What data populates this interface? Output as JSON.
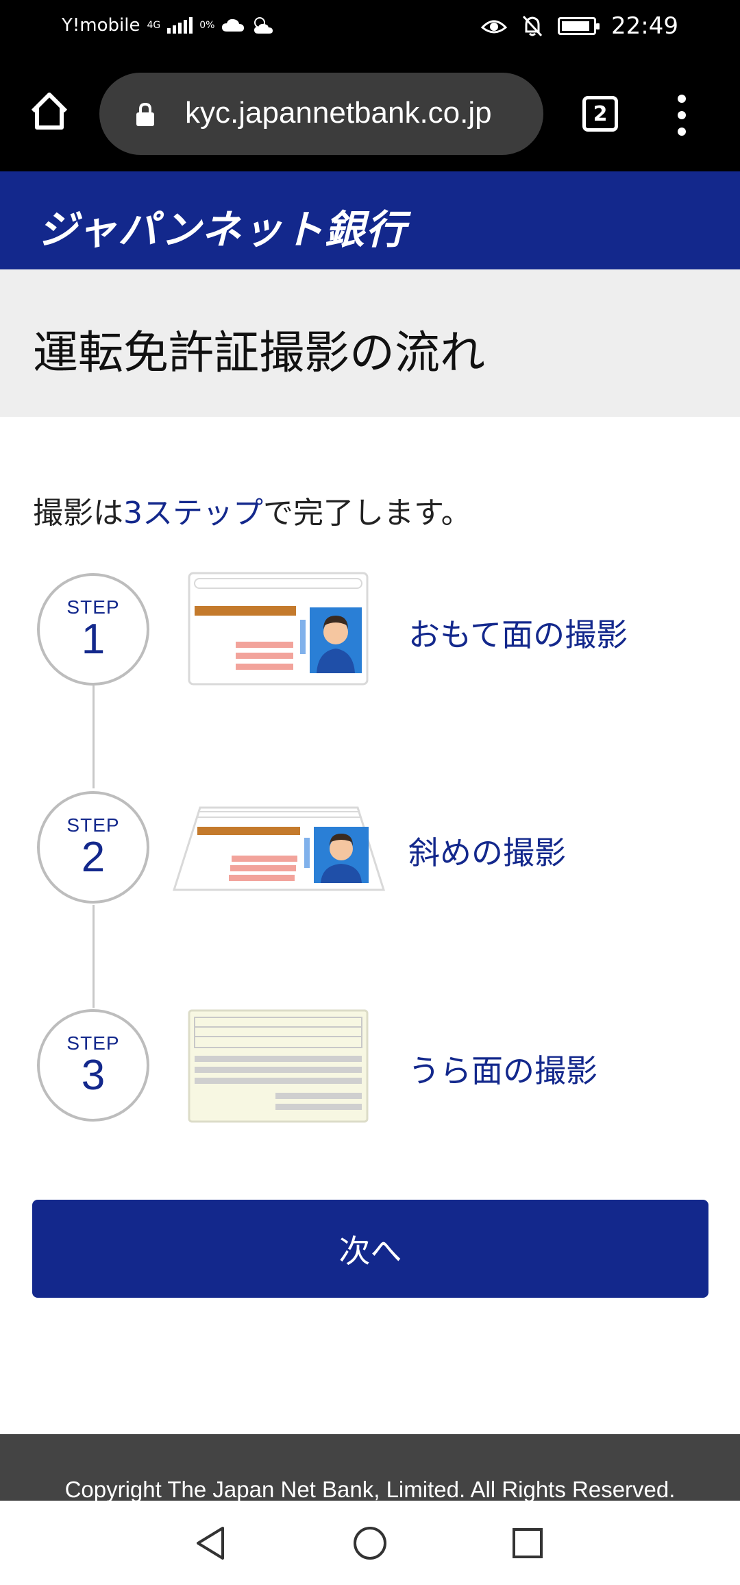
{
  "status_bar": {
    "carrier": "Y!mobile",
    "network": "4G",
    "data_saver": "0%",
    "time": "22:49",
    "battery_level": 0.9
  },
  "browser": {
    "url": "kyc.japannetbank.co.jp",
    "tab_count": "2"
  },
  "bank": {
    "logo_text": "ジャパンネット銀行",
    "brand_color": "#13288c"
  },
  "page": {
    "title": "運転免許証撮影の流れ",
    "intro_prefix": "撮影は",
    "intro_highlight": "3ステップ",
    "intro_suffix": "で完了します。"
  },
  "steps": [
    {
      "step_label": "STEP",
      "number": "1",
      "label": "おもて面の撮影",
      "image_icon": "license-front-icon"
    },
    {
      "step_label": "STEP",
      "number": "2",
      "label": "斜めの撮影",
      "image_icon": "license-angled-icon"
    },
    {
      "step_label": "STEP",
      "number": "3",
      "label": "うら面の撮影",
      "image_icon": "license-back-icon"
    }
  ],
  "next_button": {
    "label": "次へ"
  },
  "footer": {
    "copyright": "Copyright The Japan Net Bank, Limited. All Rights Reserved."
  },
  "nav": {
    "back_icon": "back-triangle-icon",
    "home_icon": "home-circle-icon",
    "recents_icon": "recents-square-icon"
  }
}
